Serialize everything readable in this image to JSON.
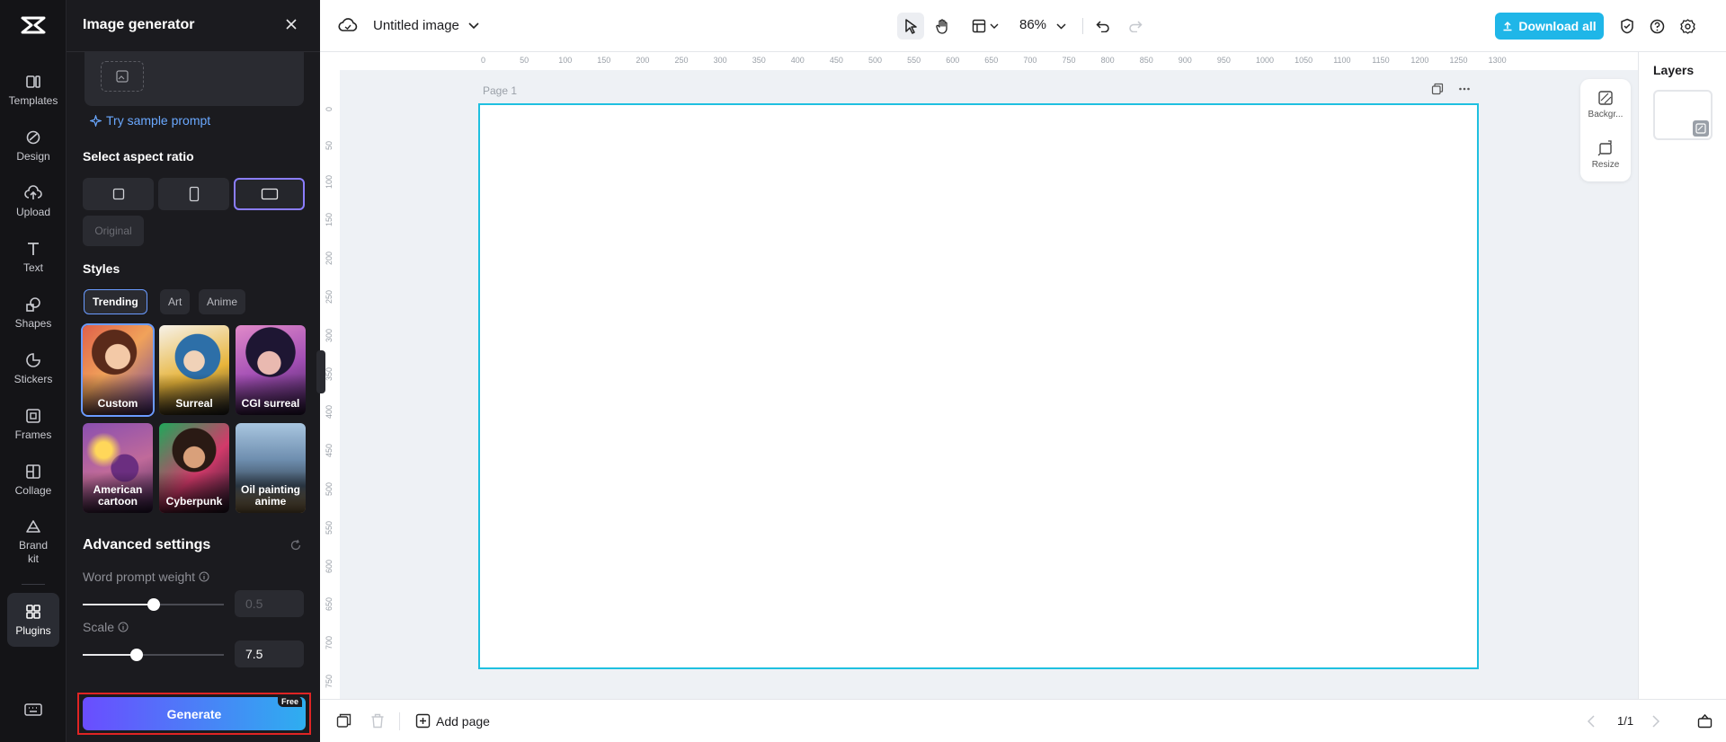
{
  "rail": {
    "items": [
      {
        "label": "Templates",
        "icon": "templates-icon"
      },
      {
        "label": "Design",
        "icon": "design-icon"
      },
      {
        "label": "Upload",
        "icon": "upload-icon"
      },
      {
        "label": "Text",
        "icon": "text-icon"
      },
      {
        "label": "Shapes",
        "icon": "shapes-icon"
      },
      {
        "label": "Stickers",
        "icon": "stickers-icon"
      },
      {
        "label": "Frames",
        "icon": "frames-icon"
      },
      {
        "label": "Collage",
        "icon": "collage-icon"
      },
      {
        "label": "Brand kit",
        "icon": "brand-kit-icon"
      },
      {
        "label": "Plugins",
        "icon": "plugins-icon"
      }
    ],
    "active": "Plugins"
  },
  "panel": {
    "title": "Image generator",
    "try_sample": "Try sample prompt",
    "aspect_label": "Select aspect ratio",
    "original_label": "Original",
    "styles_label": "Styles",
    "style_tabs": [
      "Trending",
      "Art",
      "Anime"
    ],
    "style_cards": [
      {
        "label": "Custom"
      },
      {
        "label": "Surreal"
      },
      {
        "label": "CGI surreal"
      },
      {
        "label": "American cartoon"
      },
      {
        "label": "Cyberpunk"
      },
      {
        "label": "Oil painting anime"
      }
    ],
    "advanced_title": "Advanced settings",
    "word_weight_label": "Word prompt weight",
    "word_weight_value": "0.5",
    "word_weight_level": 0.5,
    "scale_label": "Scale",
    "scale_value": "7.5",
    "scale_level": 0.38,
    "generate_label": "Generate",
    "free_tag": "Free"
  },
  "topbar": {
    "doc_title": "Untitled image",
    "zoom": "86%",
    "download_label": "Download all"
  },
  "canvas": {
    "page_label": "Page 1",
    "ruler_h": [
      "0",
      "50",
      "100",
      "150",
      "200",
      "250",
      "300",
      "350",
      "400",
      "450",
      "500",
      "550",
      "600",
      "650",
      "700",
      "750",
      "800",
      "850",
      "900",
      "950",
      "1000",
      "1050",
      "1100",
      "1150",
      "1200",
      "1250",
      "1300"
    ],
    "ruler_v": [
      "0",
      "50",
      "100",
      "150",
      "200",
      "250",
      "300",
      "350",
      "400",
      "450",
      "500",
      "550",
      "600",
      "650",
      "700",
      "750"
    ],
    "float_tools": [
      "Backgr...",
      "Resize"
    ],
    "page_border_color": "#1fc0e0"
  },
  "layers": {
    "title": "Layers"
  },
  "bottombar": {
    "add_page": "Add page",
    "page_count": "1/1"
  },
  "colors": {
    "accent": "#1fb6e8",
    "generate_start": "#6a4dff",
    "generate_end": "#2eaef0"
  }
}
